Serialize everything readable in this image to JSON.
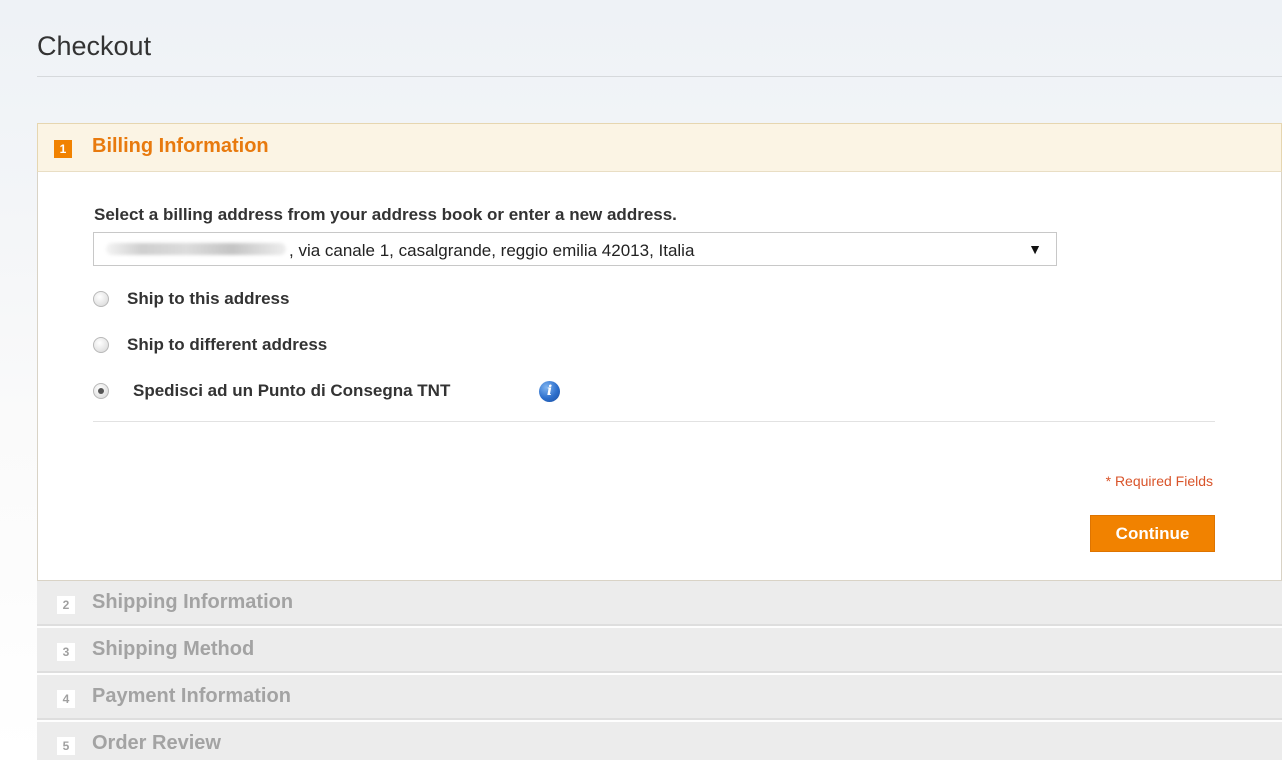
{
  "page": {
    "title": "Checkout"
  },
  "steps": [
    {
      "number": "1",
      "label": "Billing Information",
      "state": "active"
    },
    {
      "number": "2",
      "label": "Shipping Information",
      "state": "collapsed"
    },
    {
      "number": "3",
      "label": "Shipping Method",
      "state": "collapsed"
    },
    {
      "number": "4",
      "label": "Payment Information",
      "state": "collapsed"
    },
    {
      "number": "5",
      "label": "Order Review",
      "state": "collapsed"
    }
  ],
  "billing": {
    "prompt": "Select a billing address from your address book or enter a new address.",
    "address_select": {
      "selected_value": ", via canale 1, casalgrande, reggio emilia 42013, Italia",
      "arrow": "▼"
    },
    "shipping_options": [
      {
        "label": "Ship to this address",
        "checked": false
      },
      {
        "label": "Ship to different address",
        "checked": false
      },
      {
        "label": "Spedisci ad un Punto di Consegna TNT",
        "checked": true,
        "icon": "info-icon"
      }
    ],
    "info_icon_glyph": "i",
    "required_fields": "* Required Fields",
    "continue_label": "Continue"
  },
  "colors": {
    "accent": "#f18200",
    "active_header_bg": "#fbf4e4",
    "active_title": "#e87a0e",
    "required_text": "#d9542a",
    "collapsed_bg": "#ececec",
    "collapsed_text": "#a3a3a3"
  }
}
